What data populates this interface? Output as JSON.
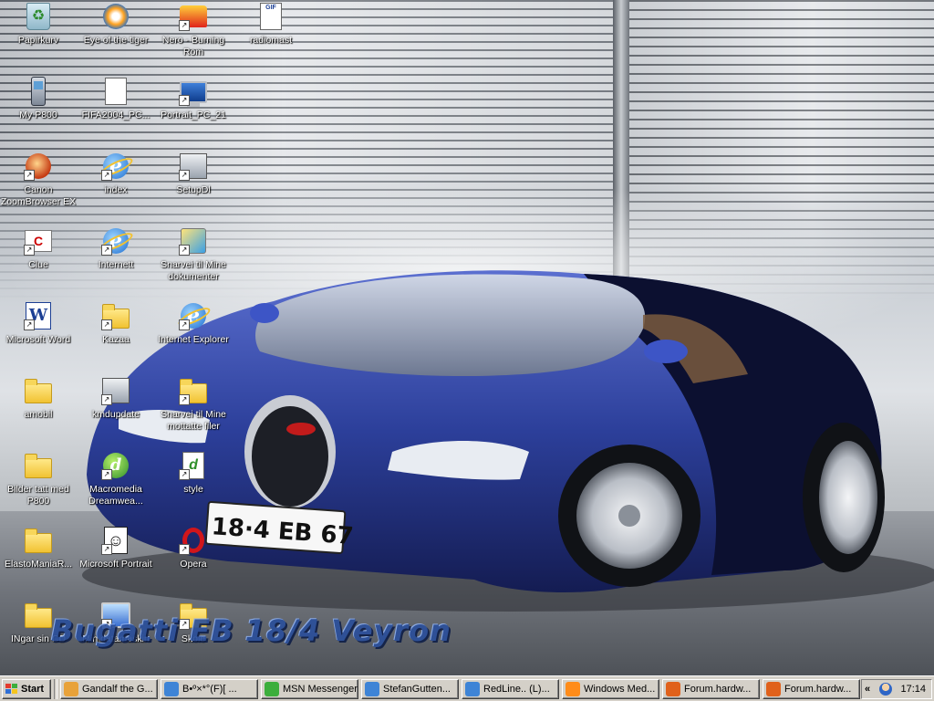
{
  "desktop": {
    "wallpaper_caption": "Bugatti EB 18/4 Veyron",
    "license_plate": "18·4 EB 67",
    "icons": [
      {
        "label": "Papirkurv",
        "icon": "recycle-bin-icon"
      },
      {
        "label": "My P800",
        "icon": "phone-icon"
      },
      {
        "label": "Canon ZoomBrowser EX",
        "icon": "canon-icon"
      },
      {
        "label": "Clue",
        "icon": "clue-icon"
      },
      {
        "label": "Microsoft Word",
        "icon": "word-icon"
      },
      {
        "label": "amobil",
        "icon": "folder-icon"
      },
      {
        "label": "Bilder tatt med P800",
        "icon": "folder-icon"
      },
      {
        "label": "ElastoManiaR...",
        "icon": "folder-icon"
      },
      {
        "label": "INgar sin CD",
        "icon": "folder-icon"
      },
      {
        "label": "Eye of the tiger",
        "icon": "media-player-icon"
      },
      {
        "label": "FIFA2004_PC...",
        "icon": "document-icon"
      },
      {
        "label": "index",
        "icon": "ie-document-icon"
      },
      {
        "label": "Internett",
        "icon": "internet-explorer-icon"
      },
      {
        "label": "Kazaa",
        "icon": "folder-icon"
      },
      {
        "label": "kmdupdate",
        "icon": "setup-icon"
      },
      {
        "label": "Macromedia Dreamwea...",
        "icon": "dreamweaver-icon"
      },
      {
        "label": "Microsoft Portrait",
        "icon": "portrait-icon"
      },
      {
        "label": "Min datamaskin",
        "icon": "my-computer-icon"
      },
      {
        "label": "Nero - Burning Rom",
        "icon": "nero-icon"
      },
      {
        "label": "Portrait_PC_21",
        "icon": "computer-icon"
      },
      {
        "label": "SetupDl",
        "icon": "setup-icon"
      },
      {
        "label": "Snarvei til Mine dokumenter",
        "icon": "shortcut-icon"
      },
      {
        "label": "Internet Explorer",
        "icon": "internet-explorer-icon"
      },
      {
        "label": "Snarvei til Mine mottatte filer",
        "icon": "folder-icon"
      },
      {
        "label": "style",
        "icon": "dreamweaver-doc-icon"
      },
      {
        "label": "Opera",
        "icon": "opera-icon"
      },
      {
        "label": "Skole",
        "icon": "folder-icon"
      },
      {
        "label": "radiomast",
        "icon": "gif-file-icon"
      }
    ]
  },
  "taskbar": {
    "start_label": "Start",
    "tasks": [
      {
        "label": "Gandalf the G...",
        "color": "#e8a23a"
      },
      {
        "label": "B•º×*°(F)[ ...",
        "color": "#3e84d6"
      },
      {
        "label": "MSN Messenger",
        "color": "#3cae3c"
      },
      {
        "label": "StefanGutten...",
        "color": "#3e84d6"
      },
      {
        "label": "RedLine.. (L)...",
        "color": "#3e84d6"
      },
      {
        "label": "Windows Med...",
        "color": "#ff8c1a"
      },
      {
        "label": "Forum.hardw...",
        "color": "#e0611b"
      },
      {
        "label": "Forum.hardw...",
        "color": "#e0611b"
      }
    ],
    "tray_toggle": "«",
    "clock": "17:14"
  },
  "colors": {
    "car_body": "#2c3f9a",
    "car_dark": "#0c1030",
    "taskbar": "#d4d0c8"
  }
}
